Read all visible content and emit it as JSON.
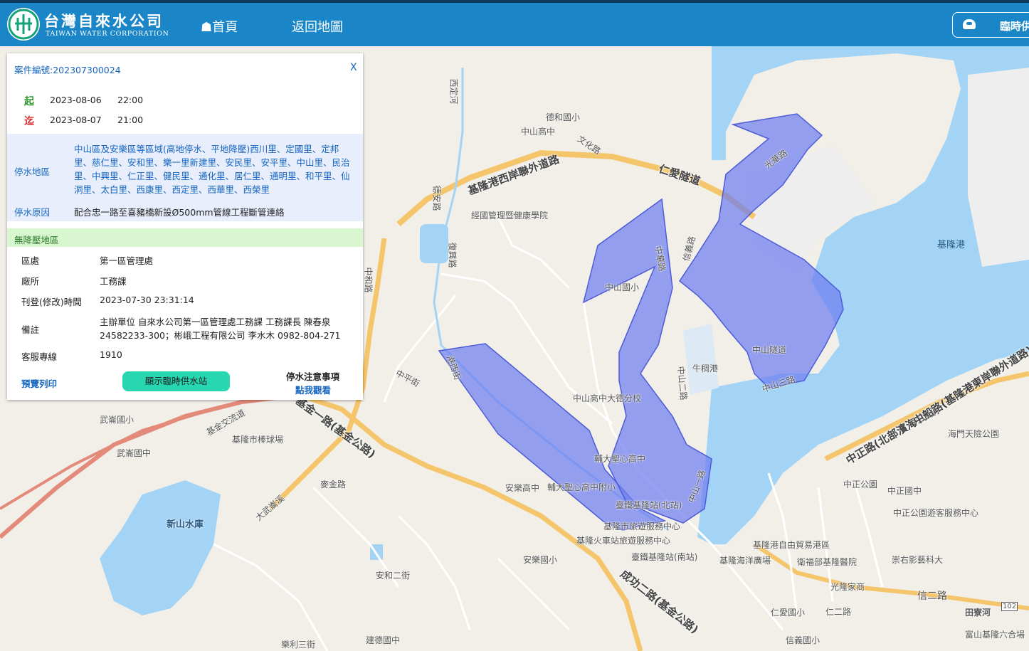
{
  "header": {
    "logo_text": "台灣自來水公司",
    "logo_text_en": "TAIWAN WATER CORPORATION",
    "nav_home": "☗首頁",
    "nav_map": "返回地圖",
    "temp_supply_label": "臨時供"
  },
  "panel": {
    "case_no": "案件編號:202307300024",
    "close": "X",
    "start_key": "起",
    "start_date": "2023-08-06",
    "start_time": "22:00",
    "end_key": "迄",
    "end_date": "2023-08-07",
    "end_time": "21:00",
    "area_label": "停水地區",
    "area_value": "中山區及安樂區等區域(高地停水、平地降壓)西川里、定國里、定邦里、慈仁里、安和里、樂一里新建里、安民里、安平里、中山里、民治里、中興里、仁正里、健民里、通化里、居仁里、通明里、和平里、仙洞里、太白里、西康里、西定里、西華里、西榮里",
    "reason_label": "停水原因",
    "reason_value": "配合忠一路至喜豬橋新設Ø500mm管線工程斷管連絡",
    "no_pressure_label": "無降壓地區",
    "rows": [
      {
        "key": "區處",
        "value": "第一區管理處"
      },
      {
        "key": "廠所",
        "value": "工務課"
      },
      {
        "key": "刊登(修改)時間",
        "value": "2023-07-30 23:31:14"
      },
      {
        "key": "備註",
        "value": "主辦單位 自來水公司第一區管理處工務課 工務課長 陳春泉 24582233-300；彬峨工程有限公司 李水木 0982-804-271"
      },
      {
        "key": "客服專線",
        "value": "1910"
      }
    ],
    "print_label": "預覽列印",
    "show_temp_label": "顯示臨時供水站",
    "notice_label": "停水注意事項",
    "click_label": "點我觀看"
  },
  "map": {
    "labels": [
      "德和國小",
      "中山高中",
      "經國管理暨健康學院",
      "中山國小",
      "中山高中大德分校",
      "輔大聖心高中",
      "安樂高中",
      "輔大聖心高中附小",
      "臺鐵基隆站(北站)",
      "基隆市旅遊服務中心",
      "基隆火車站旅遊服務中心",
      "臺鐵基隆站(南站)",
      "安樂國小",
      "武崙國小",
      "武崙國中",
      "基隆市棒球場",
      "麥金路",
      "新山水庫",
      "建德國中",
      "樂利三街",
      "安和二街",
      "基隆港",
      "牛稠港",
      "中正公園",
      "中正國中",
      "中正公園遊客服務中心",
      "海門天險公園",
      "基隆港自由貿易港區",
      "基隆海洋廣場",
      "衛福部基隆醫院",
      "光隆家商",
      "崇右影藝科大",
      "仁愛國小",
      "信義國小",
      "田寮河",
      "富山基隆六合場",
      "中平街",
      "仁二路",
      "信二路",
      "102",
      "西定河"
    ],
    "roads": [
      "基隆港西岸聯外道路",
      "仁愛隧道",
      "中山隧道",
      "中山三路",
      "光華路",
      "文化路",
      "基金一路(基金公路)",
      "基金交流道",
      "成功二路(基金公路)",
      "中正路(北部濱海公路)",
      "中山一路",
      "中華路",
      "中山二路",
      "復興路",
      "信義路",
      "大武崙溪",
      "中和路",
      "德安路",
      "港西街",
      "中船路(基隆港東岸聯外道路)"
    ],
    "colors": {
      "outage_fill": "#6f7ef0",
      "water": "#a3d3f5",
      "land": "#f2efe9",
      "header": "#1a86c8",
      "highway": "#f5c56b"
    }
  }
}
